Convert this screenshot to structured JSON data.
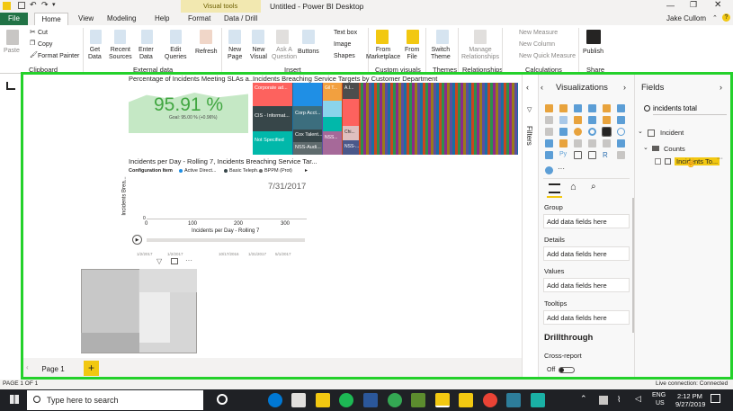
{
  "titlebar": {
    "title": "Untitled - Power BI Desktop",
    "context_tab": "Visual tools",
    "user": "Jake Cullom"
  },
  "tabs": [
    "File",
    "Home",
    "View",
    "Modeling",
    "Help",
    "Format",
    "Data / Drill"
  ],
  "ribbon": {
    "paste": "Paste",
    "cut": "Cut",
    "copy": "Copy",
    "format_painter": "Format Painter",
    "get_data": "Get\nData",
    "recent_sources": "Recent\nSources",
    "enter_data": "Enter\nData",
    "edit_queries": "Edit\nQueries",
    "refresh": "Refresh",
    "new_page": "New\nPage",
    "new_visual": "New\nVisual",
    "ask_question": "Ask A\nQuestion",
    "buttons": "Buttons",
    "text_box": "Text box",
    "image": "Image",
    "shapes": "Shapes",
    "from_marketplace": "From\nMarketplace",
    "from_file": "From\nFile",
    "switch_theme": "Switch\nTheme",
    "manage_relationships": "Manage\nRelationships",
    "new_measure": "New Measure",
    "new_column": "New Column",
    "new_quick_measure": "New Quick Measure",
    "publish": "Publish",
    "groups": [
      "Clipboard",
      "External data",
      "Insert",
      "Custom visuals",
      "Themes",
      "Relationships",
      "Calculations",
      "Share"
    ]
  },
  "canvas": {
    "kpi_title": "Percentage of Incidents Meeting SLAs a...",
    "kpi_value": "95.91 %",
    "kpi_goal": "Goal: 95.00 % (+0.96%)",
    "treemap_title": "Incidents Breaching Service Targets by Customer Department",
    "treemap_labels": [
      "Corporate ad...",
      "CIS - Informat...",
      "Not Specified",
      "Corp Acct...",
      "Cox Talent...",
      "NSS-Audi...",
      "Gil T...",
      "A.I...",
      "NSS...",
      "NSS-...",
      "Chi..."
    ],
    "line_title": "Incidents per Day - Rolling 7, Incidents Breaching Service Tar...",
    "legend_label": "Configuration Item",
    "legend_items": [
      "Active Direct...",
      "Basic Teleph...",
      "BPPM (Prot)"
    ],
    "date_display": "7/31/2017",
    "y_axis": "Incidents Brea...",
    "x_axis": "Incidents per Day - Rolling 7",
    "x_ticks": [
      "0",
      "100",
      "200",
      "300"
    ],
    "y_tick": "0",
    "timeline_dates": [
      "1/2/2017",
      "1/2/2017",
      "10/17/2016",
      "1/31/2017",
      "5/1/2017"
    ]
  },
  "pages": {
    "tab1": "Page 1",
    "add": "+"
  },
  "visualizations": {
    "title": "Visualizations",
    "wells": [
      {
        "label": "Group",
        "placeholder": "Add data fields here"
      },
      {
        "label": "Details",
        "placeholder": "Add data fields here"
      },
      {
        "label": "Values",
        "placeholder": "Add data fields here"
      },
      {
        "label": "Tooltips",
        "placeholder": "Add data fields here"
      }
    ],
    "drillthrough": "Drillthrough",
    "cross_report": "Cross-report",
    "toggle_state": "Off"
  },
  "filters": {
    "label": "Filters"
  },
  "fields": {
    "title": "Fields",
    "search_value": "incidents total",
    "table": "Incident",
    "folder": "Counts",
    "field_item": "Incidents To..."
  },
  "status": {
    "page_info": "PAGE 1 OF 1",
    "connection": "Live connection: Connected"
  },
  "taskbar": {
    "search_placeholder": "Type here to search",
    "lang": "ENG",
    "region": "US",
    "time": "2:12 PM",
    "date": "9/27/2019"
  },
  "colors": {
    "accent": "#f2c811",
    "file_tab": "#217346",
    "highlight_border": "#24d12b",
    "kpi_green": "#c5e8c5"
  }
}
